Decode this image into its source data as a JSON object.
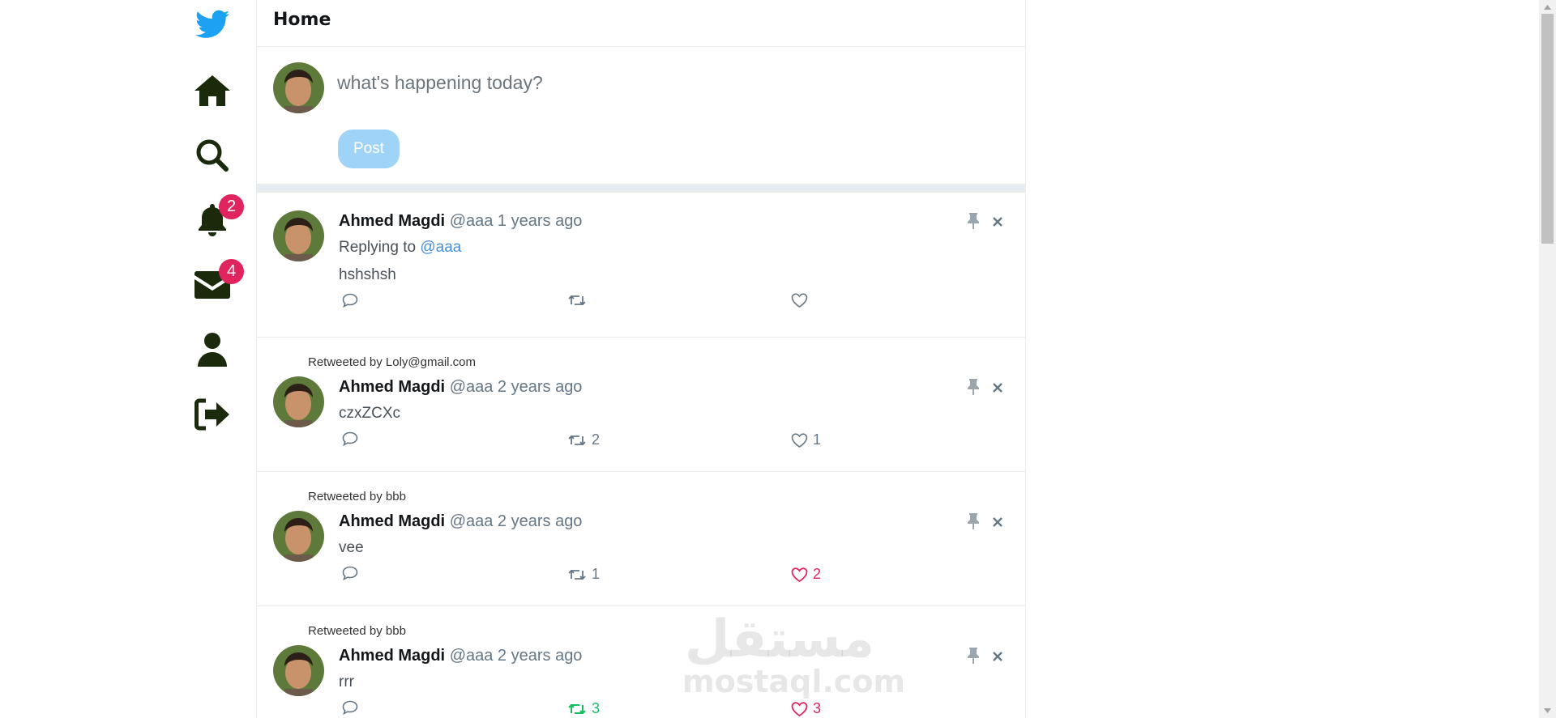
{
  "sidebar": {
    "notifications_badge": "2",
    "messages_badge": "4"
  },
  "main": {
    "title": "Home"
  },
  "compose": {
    "placeholder": "what's happening today?",
    "post_label": "Post"
  },
  "posts": [
    {
      "retweeted_by": "",
      "name": "Ahmed Magdi",
      "handle": "@aaa",
      "time": "1 years ago",
      "replying_prefix": "Replying to",
      "replying_to": "@aaa",
      "content": "hshshsh",
      "retweets": "",
      "likes": ""
    },
    {
      "retweeted_by": "Retweeted by Loly@gmail.com",
      "name": "Ahmed Magdi",
      "handle": "@aaa",
      "time": "2 years ago",
      "content": "czxZCXc",
      "retweets": "2",
      "likes": "1"
    },
    {
      "retweeted_by": "Retweeted by bbb",
      "name": "Ahmed Magdi",
      "handle": "@aaa",
      "time": "2 years ago",
      "content": "vee",
      "retweets": "1",
      "likes": "2",
      "liked": true
    },
    {
      "retweeted_by": "Retweeted by bbb",
      "name": "Ahmed Magdi",
      "handle": "@aaa",
      "time": "2 years ago",
      "content": "rrr",
      "retweets": "3",
      "likes": "3",
      "liked": true,
      "retweeted": true
    }
  ],
  "watermark": {
    "arabic": "مستقل",
    "latin": "mostaql.com"
  },
  "colors": {
    "brand": "#1da1f2",
    "badge": "#e0245e",
    "like": "#e0245e",
    "retweet": "#17bf63",
    "post_button": "#9fd3f7",
    "link": "#4a90d9"
  },
  "icons": [
    "twitter-logo-icon",
    "home-icon",
    "search-icon",
    "bell-icon",
    "envelope-icon",
    "user-icon",
    "sign-out-icon",
    "pin-icon",
    "close-icon",
    "comment-icon",
    "retweet-icon",
    "heart-icon"
  ]
}
